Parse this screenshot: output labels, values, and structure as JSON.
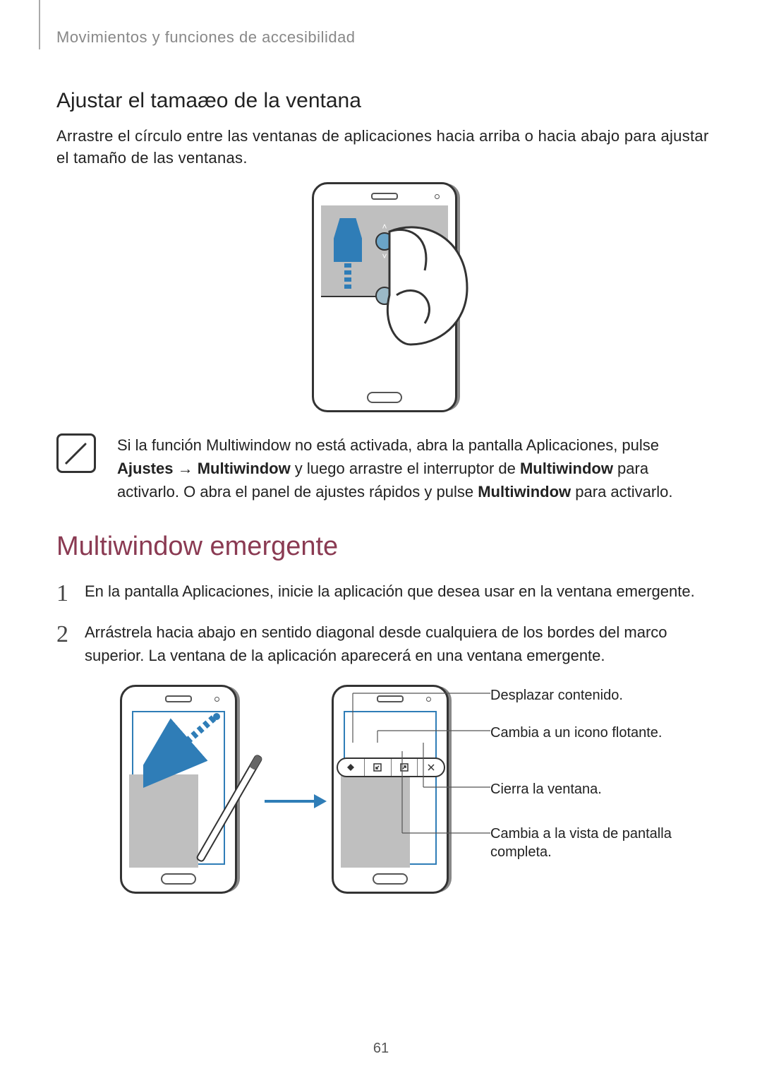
{
  "running_head": "Movimientos y funciones de accesibilidad",
  "section1": {
    "title": "Ajustar el tamaæo de la ventana",
    "body": "Arrastre el círculo entre las ventanas de aplicaciones hacia arriba o hacia abajo para ajustar el tamaño de las ventanas."
  },
  "note": {
    "text_before": "Si la función Multiwindow no está activada, abra la pantalla Aplicaciones, pulse ",
    "bold1": "Ajustes",
    "arrow": " → ",
    "bold2": "Multiwindow",
    "text_mid": " y luego arrastre el interruptor de ",
    "bold3": "Multiwindow",
    "text_mid2": " para activarlo. O abra el panel de ajustes rápidos y pulse ",
    "bold4": "Multiwindow",
    "text_after": " para activarlo."
  },
  "section2": {
    "title": "Multiwindow emergente",
    "steps": [
      "En la pantalla Aplicaciones, inicie la aplicación que desea usar en la ventana emergente.",
      "Arrástrela hacia abajo en sentido diagonal desde cualquiera de los bordes del marco superior. La ventana de la aplicación aparecerá en una ventana emergente."
    ],
    "callouts": {
      "desplazar": "Desplazar contenido.",
      "flotante": "Cambia a un icono flotante.",
      "cerrar": "Cierra la ventana.",
      "pantalla_completa": "Cambia a la vista de pantalla completa."
    }
  },
  "page_number": "61"
}
